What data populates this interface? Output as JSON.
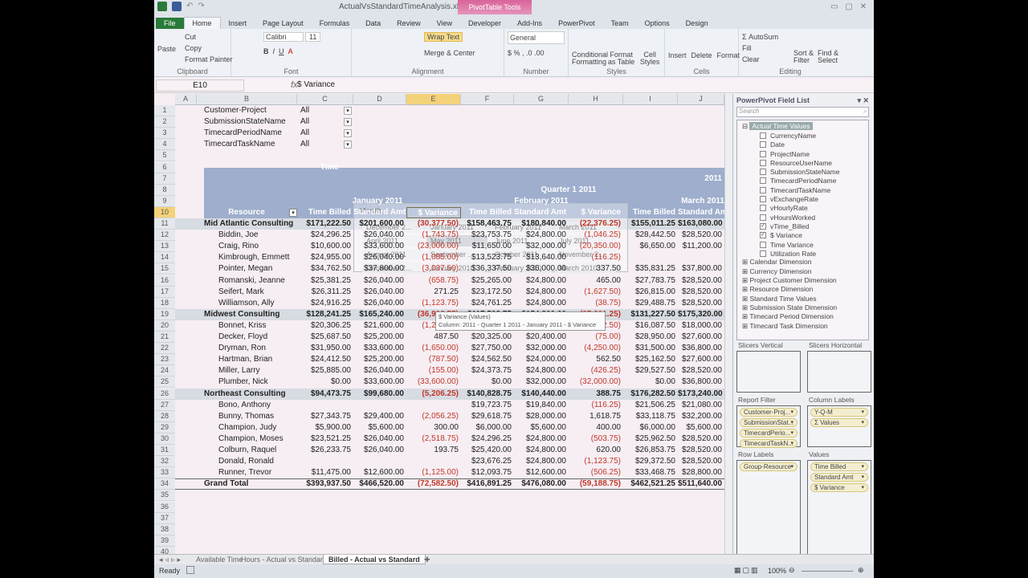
{
  "window": {
    "title": "ActualVsStandardTimeAnalysis.xlsx - Microsoft Excel",
    "contextual_tab": "PivotTable Tools"
  },
  "ribbon_tabs": [
    "File",
    "Home",
    "Insert",
    "Page Layout",
    "Formulas",
    "Data",
    "Review",
    "View",
    "Developer",
    "Add-Ins",
    "PowerPivot",
    "Team",
    "Options",
    "Design"
  ],
  "ribbon": {
    "clipboard": {
      "label": "Clipboard",
      "paste": "Paste",
      "cut": "Cut",
      "copy": "Copy",
      "format_painter": "Format Painter"
    },
    "font": {
      "label": "Font",
      "name": "Calibri",
      "size": "11"
    },
    "alignment": {
      "label": "Alignment",
      "wrap": "Wrap Text",
      "merge": "Merge & Center"
    },
    "number": {
      "label": "Number",
      "format": "General"
    },
    "styles": {
      "label": "Styles",
      "cond": "Conditional Formatting",
      "table": "Format as Table",
      "cell": "Cell Styles"
    },
    "cells": {
      "label": "Cells",
      "insert": "Insert",
      "delete": "Delete",
      "format": "Format"
    },
    "editing": {
      "label": "Editing",
      "autosum": "AutoSum",
      "fill": "Fill",
      "clear": "Clear",
      "sort": "Sort & Filter",
      "find": "Find & Select"
    }
  },
  "formula_bar": {
    "name_box": "E10",
    "fx": "fx",
    "value": "$ Variance"
  },
  "columns": [
    "A",
    "B",
    "C",
    "D",
    "E",
    "F",
    "G",
    "H",
    "I",
    "J"
  ],
  "selected_column": "E",
  "report_filters": [
    {
      "label": "Customer-Project",
      "value": "All"
    },
    {
      "label": "SubmissionStateName",
      "value": "All"
    },
    {
      "label": "TimecardPeriodName",
      "value": "All"
    },
    {
      "label": "TimecardTaskName",
      "value": "All"
    }
  ],
  "month_slicer": {
    "title": "Month",
    "items": [
      "December 2...",
      "January 2011",
      "February 2011",
      "March 2011",
      "April 2011",
      "May 2011",
      "June 2011",
      "July 2011",
      "August 2011",
      "September ...",
      "October 2011",
      "November 2...",
      "December 2...",
      "January 2010",
      "February 2010",
      "March 2010"
    ]
  },
  "pivot": {
    "time_label": "Time",
    "year": "2011",
    "quarter": "Quarter 1 2011",
    "months": [
      "January 2011",
      "February 2011",
      "March 2011"
    ],
    "row_header": "Resource",
    "value_headers": [
      "Time Billed",
      "Standard Amt",
      "$ Variance"
    ],
    "rows": [
      {
        "name": "Mid Atlantic Consulting",
        "group": true,
        "v": [
          "$171,222.50",
          "$201,600.00",
          "(30,377.50)",
          "$158,463.75",
          "$180,840.00",
          "(22,376.25)",
          "$155,011.25",
          "$163,080.00"
        ]
      },
      {
        "name": "Biddin, Joe",
        "v": [
          "$24,296.25",
          "$26,040.00",
          "(1,743.75)",
          "$23,753.75",
          "$24,800.00",
          "(1,046.25)",
          "$28,442.50",
          "$28,520.00"
        ]
      },
      {
        "name": "Craig, Rino",
        "v": [
          "$10,600.00",
          "$33,600.00",
          "(23,000.00)",
          "$11,650.00",
          "$32,000.00",
          "(20,350.00)",
          "$6,650.00",
          "$11,200.00"
        ]
      },
      {
        "name": "Kimbrough, Emmett",
        "v": [
          "$24,955.00",
          "$26,040.00",
          "(1,085.00)",
          "$13,523.75",
          "$13,640.00",
          "(116.25)",
          "",
          ""
        ]
      },
      {
        "name": "Pointer, Megan",
        "v": [
          "$34,762.50",
          "$37,800.00",
          "(3,037.50)",
          "$36,337.50",
          "$36,000.00",
          "337.50",
          "$35,831.25",
          "$37,800.00"
        ]
      },
      {
        "name": "Romanski, Jeanne",
        "v": [
          "$25,381.25",
          "$26,040.00",
          "(658.75)",
          "$25,265.00",
          "$24,800.00",
          "465.00",
          "$27,783.75",
          "$28,520.00"
        ]
      },
      {
        "name": "Seifert, Mark",
        "v": [
          "$26,311.25",
          "$26,040.00",
          "271.25",
          "$23,172.50",
          "$24,800.00",
          "(1,627.50)",
          "$26,815.00",
          "$28,520.00"
        ]
      },
      {
        "name": "Williamson, Ally",
        "v": [
          "$24,916.25",
          "$26,040.00",
          "(1,123.75)",
          "$24,761.25",
          "$24,800.00",
          "(38.75)",
          "$29,488.75",
          "$28,520.00"
        ]
      },
      {
        "name": "Midwest Consulting",
        "group": true,
        "v": [
          "$128,241.25",
          "$165,240.00",
          "(36,998.75)",
          "$117,598.75",
          "$154,800.00",
          "(37,201.25)",
          "$131,227.50",
          "$175,320.00"
        ]
      },
      {
        "name": "Bonnet, Kriss",
        "v": [
          "$20,306.25",
          "$21,600.00",
          "(1,293.75)",
          "$20,587.50",
          "$21,600.00",
          "(1,012.50)",
          "$16,087.50",
          "$18,000.00"
        ]
      },
      {
        "name": "Decker, Floyd",
        "v": [
          "$25,687.50",
          "$25,200.00",
          "487.50",
          "$20,325.00",
          "$20,400.00",
          "(75.00)",
          "$28,950.00",
          "$27,600.00"
        ]
      },
      {
        "name": "Dryman, Ron",
        "v": [
          "$31,950.00",
          "$33,600.00",
          "(1,650.00)",
          "$27,750.00",
          "$32,000.00",
          "(4,250.00)",
          "$31,500.00",
          "$36,800.00"
        ]
      },
      {
        "name": "Hartman, Brian",
        "v": [
          "$24,412.50",
          "$25,200.00",
          "(787.50)",
          "$24,562.50",
          "$24,000.00",
          "562.50",
          "$25,162.50",
          "$27,600.00"
        ]
      },
      {
        "name": "Miller, Larry",
        "v": [
          "$25,885.00",
          "$26,040.00",
          "(155.00)",
          "$24,373.75",
          "$24,800.00",
          "(426.25)",
          "$29,527.50",
          "$28,520.00"
        ]
      },
      {
        "name": "Plumber, Nick",
        "v": [
          "$0.00",
          "$33,600.00",
          "(33,600.00)",
          "$0.00",
          "$32,000.00",
          "(32,000.00)",
          "$0.00",
          "$36,800.00"
        ]
      },
      {
        "name": "Northeast Consulting",
        "group": true,
        "v": [
          "$94,473.75",
          "$99,680.00",
          "(5,206.25)",
          "$140,828.75",
          "$140,440.00",
          "388.75",
          "$176,282.50",
          "$173,240.00"
        ]
      },
      {
        "name": "Bono, Anthony",
        "v": [
          "",
          "",
          "",
          "$19,723.75",
          "$19,840.00",
          "(116.25)",
          "$21,506.25",
          "$21,080.00"
        ]
      },
      {
        "name": "Bunny, Thomas",
        "v": [
          "$27,343.75",
          "$29,400.00",
          "(2,056.25)",
          "$29,618.75",
          "$28,000.00",
          "1,618.75",
          "$33,118.75",
          "$32,200.00"
        ]
      },
      {
        "name": "Champion, Judy",
        "v": [
          "$5,900.00",
          "$5,600.00",
          "300.00",
          "$6,000.00",
          "$5,600.00",
          "400.00",
          "$6,000.00",
          "$5,600.00"
        ]
      },
      {
        "name": "Champion, Moses",
        "v": [
          "$23,521.25",
          "$26,040.00",
          "(2,518.75)",
          "$24,296.25",
          "$24,800.00",
          "(503.75)",
          "$25,962.50",
          "$28,520.00"
        ]
      },
      {
        "name": "Colburn, Raquel",
        "v": [
          "$26,233.75",
          "$26,040.00",
          "193.75",
          "$25,420.00",
          "$24,800.00",
          "620.00",
          "$26,853.75",
          "$28,520.00"
        ]
      },
      {
        "name": "Donald, Ronald",
        "v": [
          "",
          "",
          "",
          "$23,676.25",
          "$24,800.00",
          "(1,123.75)",
          "$29,372.50",
          "$28,520.00"
        ]
      },
      {
        "name": "Runner, Trevor",
        "v": [
          "$11,475.00",
          "$12,600.00",
          "(1,125.00)",
          "$12,093.75",
          "$12,600.00",
          "(506.25)",
          "$33,468.75",
          "$28,800.00"
        ]
      },
      {
        "name": "Grand Total",
        "total": true,
        "v": [
          "$393,937.50",
          "$466,520.00",
          "(72,582.50)",
          "$416,891.25",
          "$476,080.00",
          "(59,188.75)",
          "$462,521.25",
          "$511,640.00"
        ]
      }
    ]
  },
  "tooltip": {
    "line1": "$ Variance (Values)",
    "line2": "Column: 2011 - Quarter 1 2011 - January 2011 - $ Variance"
  },
  "field_list": {
    "title": "PowerPivot Field List",
    "search_placeholder": "Search",
    "table": "Actual Time Values",
    "fields": [
      {
        "name": "CurrencyName",
        "checked": false
      },
      {
        "name": "Date",
        "checked": false
      },
      {
        "name": "ProjectName",
        "checked": false
      },
      {
        "name": "ResourceUserName",
        "checked": false
      },
      {
        "name": "SubmissionStateName",
        "checked": false
      },
      {
        "name": "TimecardPeriodName",
        "checked": false
      },
      {
        "name": "TimecardTaskName",
        "checked": false
      },
      {
        "name": "vExchangeRate",
        "checked": false
      },
      {
        "name": "vHourlyRate",
        "checked": false
      },
      {
        "name": "vHoursWorked",
        "checked": false
      },
      {
        "name": "vTime_Billed",
        "checked": true
      },
      {
        "name": "$ Variance",
        "checked": true
      },
      {
        "name": "Time Variance",
        "checked": false
      },
      {
        "name": "Utilization Rate",
        "checked": false
      }
    ],
    "dimensions": [
      "Calendar Dimension",
      "Currency Dimension",
      "Project Customer Dimension",
      "Resource Dimension",
      "Standard Time Values",
      "Submission State Dimension",
      "Timecard Period Dimension",
      "Timecard Task Dimension"
    ],
    "areas": {
      "slicers_vertical": "Slicers Vertical",
      "slicers_horizontal": "Slicers Horizontal",
      "report_filter": "Report Filter",
      "column_labels": "Column Labels",
      "row_labels": "Row Labels",
      "values": "Values",
      "report_filter_items": [
        "Customer-Proj...",
        "SubmissionStat...",
        "TimecardPerio...",
        "TimecardTaskN..."
      ],
      "column_items": [
        "Y-Q-M",
        "Σ Values"
      ],
      "row_items": [
        "Group-Resource"
      ],
      "value_items": [
        "Time Billed",
        "Standard Amt",
        "$ Variance"
      ]
    }
  },
  "sheet_tabs": [
    "Available Time",
    "Hours - Actual vs Standard",
    "Billed - Actual vs Standard"
  ],
  "active_sheet": "Billed - Actual vs Standard",
  "status": {
    "ready": "Ready",
    "zoom": "100%"
  }
}
